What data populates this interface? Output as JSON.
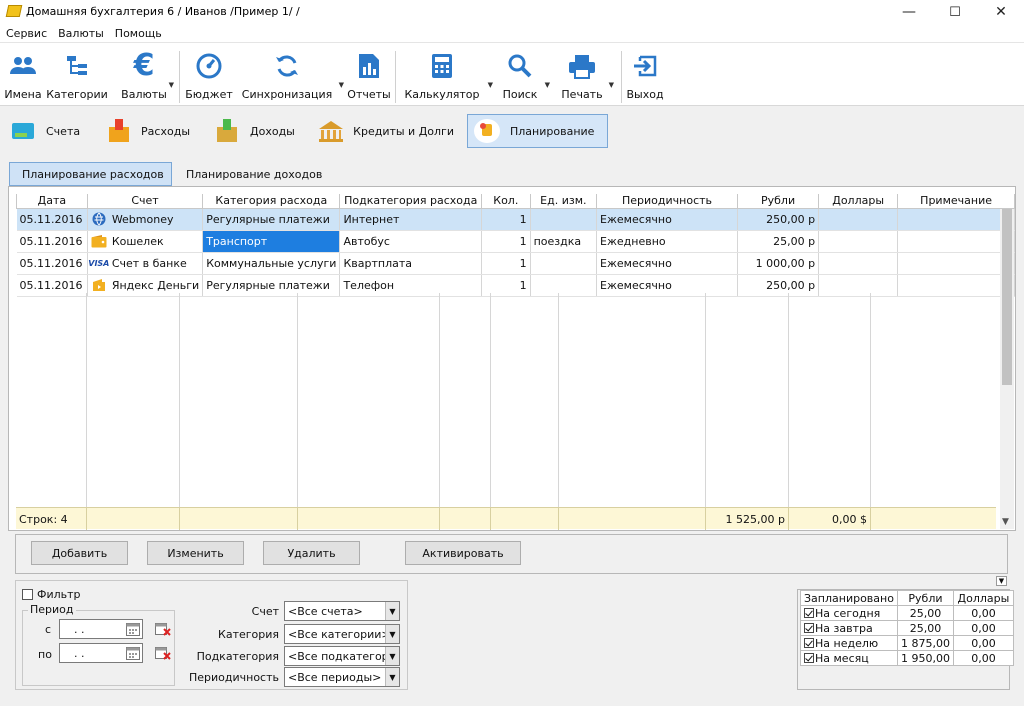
{
  "window": {
    "title": "Домашняя бухгалтерия 6  / Иванов /Пример 1/ /",
    "minimize": "—",
    "maximize": "☐",
    "close": "✕"
  },
  "menu": [
    "Сервис",
    "Валюты",
    "Помощь"
  ],
  "toolbar": {
    "names": "Имена",
    "categories": "Категории",
    "currencies": "Валюты",
    "budget": "Бюджет",
    "sync": "Синхронизация",
    "reports": "Отчеты",
    "calculator": "Калькулятор",
    "search": "Поиск",
    "print": "Печать",
    "exit": "Выход",
    "currency_symbol": "€"
  },
  "sections": [
    "Счета",
    "Расходы",
    "Доходы",
    "Кредиты и Долги",
    "Планирование"
  ],
  "subtabs": [
    "Планирование расходов",
    "Планирование доходов"
  ],
  "grid": {
    "headers": [
      "Дата",
      "Счет",
      "Категория расхода",
      "Подкатегория расхода",
      "Кол.",
      "Ед. изм.",
      "Периодичность",
      "Рубли",
      "Доллары",
      "Примечание"
    ],
    "rows": [
      {
        "date": "05.11.2016",
        "account": "Webmoney",
        "category": "Регулярные платежи",
        "subcategory": "Интернет",
        "qty": "1",
        "unit": "",
        "period": "Ежемесячно",
        "rub": "250,00 р",
        "usd": "",
        "note": ""
      },
      {
        "date": "05.11.2016",
        "account": "Кошелек",
        "category": "Транспорт",
        "subcategory": "Автобус",
        "qty": "1",
        "unit": "поездка",
        "period": "Ежедневно",
        "rub": "25,00 р",
        "usd": "",
        "note": ""
      },
      {
        "date": "05.11.2016",
        "account": "Счет в банке",
        "category": "Коммунальные услуги",
        "subcategory": "Квартплата",
        "qty": "1",
        "unit": "",
        "period": "Ежемесячно",
        "rub": "1 000,00 р",
        "usd": "",
        "note": ""
      },
      {
        "date": "05.11.2016",
        "account": "Яндекс Деньги",
        "category": "Регулярные платежи",
        "subcategory": "Телефон",
        "qty": "1",
        "unit": "",
        "period": "Ежемесячно",
        "rub": "250,00 р",
        "usd": "",
        "note": ""
      }
    ],
    "footer": {
      "rows": "Строк: 4",
      "rub_total": "1 525,00 р",
      "usd_total": "0,00 $"
    },
    "visa_text": "VISA"
  },
  "buttons": [
    "Добавить",
    "Изменить",
    "Удалить",
    "Активировать"
  ],
  "filter": {
    "label": "Фильтр",
    "period_legend": "Период",
    "from_label": "с",
    "to_label": "по",
    "from_value": ".  .",
    "to_value": ".  .",
    "account_label": "Счет",
    "account_value": "<Все счета>",
    "category_label": "Категория",
    "category_value": "<Все категории>",
    "subcategory_label": "Подкатегория",
    "subcategory_value": "<Все подкатегории>",
    "periodicity_label": "Периодичность",
    "periodicity_value": "<Все периоды>"
  },
  "summary": {
    "headers": [
      "Запланировано",
      "Рубли",
      "Доллары"
    ],
    "rows": [
      {
        "label": "На сегодня",
        "rub": "25,00",
        "usd": "0,00"
      },
      {
        "label": "На завтра",
        "rub": "25,00",
        "usd": "0,00"
      },
      {
        "label": "На неделю",
        "rub": "1 875,00",
        "usd": "0,00"
      },
      {
        "label": "На месяц",
        "rub": "1 950,00",
        "usd": "0,00"
      }
    ]
  },
  "colors": {
    "accent": "#1e7ee0",
    "selection": "#cde3f7",
    "toolbar_icon": "#2b78c8",
    "footer": "#fdf7d6"
  }
}
